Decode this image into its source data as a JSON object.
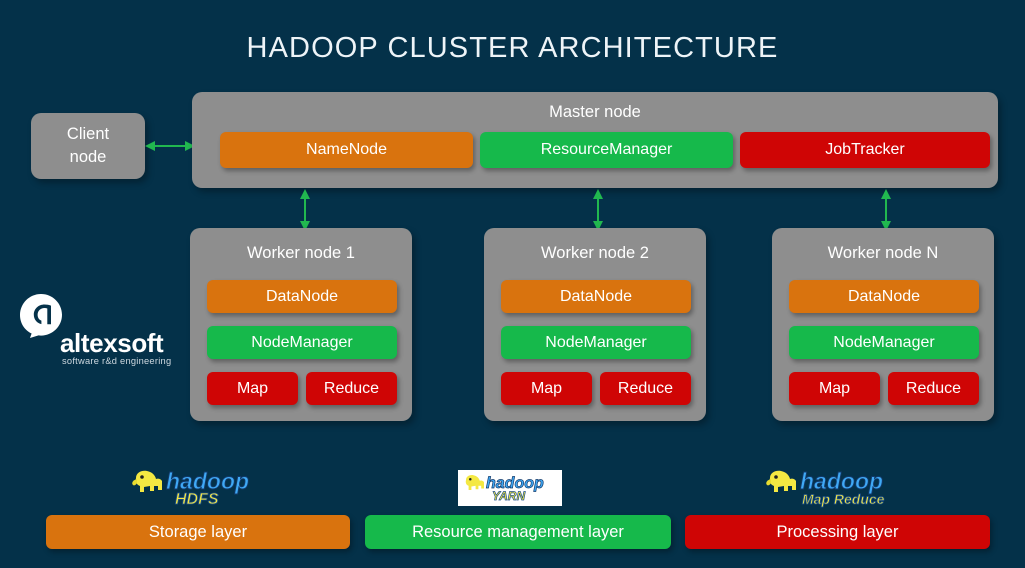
{
  "page": {
    "title": "HADOOP CLUSTER ARCHITECTURE",
    "background_color": "#043149",
    "accent_orange": "#d9730e",
    "accent_green": "#16b94b",
    "accent_red": "#cf0505",
    "node_gray": "#8e8e8e",
    "arrow_color": "#21b84f"
  },
  "client": {
    "line1": "Client",
    "line2": "node"
  },
  "master": {
    "title": "Master node",
    "services": [
      {
        "label": "NameNode",
        "color": "#d9730e"
      },
      {
        "label": "ResourceManager",
        "color": "#16b94b"
      },
      {
        "label": "JobTracker",
        "color": "#cf0505"
      }
    ]
  },
  "workers": [
    {
      "title": "Worker node 1",
      "datanode": "DataNode",
      "nodemanager": "NodeManager",
      "map": "Map",
      "reduce": "Reduce"
    },
    {
      "title": "Worker node 2",
      "datanode": "DataNode",
      "nodemanager": "NodeManager",
      "map": "Map",
      "reduce": "Reduce"
    },
    {
      "title": "Worker node N",
      "datanode": "DataNode",
      "nodemanager": "NodeManager",
      "map": "Map",
      "reduce": "Reduce"
    }
  ],
  "legend": {
    "bars": [
      {
        "label": "Storage layer",
        "color": "#d9730e"
      },
      {
        "label": "Resource management layer",
        "color": "#16b94b"
      },
      {
        "label": "Processing layer",
        "color": "#cf0505"
      }
    ],
    "logos": [
      {
        "word": "hadoop",
        "sub": "HDFS"
      },
      {
        "word": "hadoop",
        "sub": "YARN"
      },
      {
        "word": "hadoop",
        "sub": "Map Reduce"
      }
    ]
  },
  "branding": {
    "name": "altexsoft",
    "tagline": "software r&d engineering"
  }
}
